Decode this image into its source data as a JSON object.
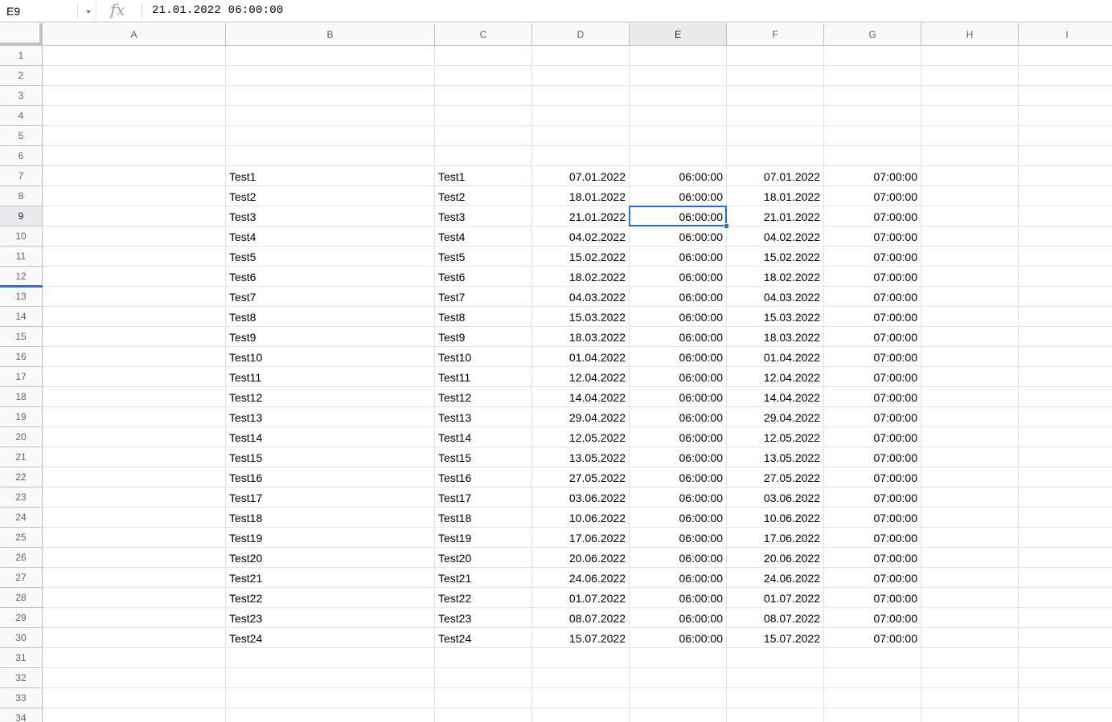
{
  "name_box": {
    "value": "E9"
  },
  "formula_bar": {
    "fx_label": "fx",
    "content": "21.01.2022 06:00:00"
  },
  "sheet": {
    "columns": [
      "A",
      "B",
      "C",
      "D",
      "E",
      "F",
      "G",
      "H",
      "I"
    ],
    "row_numbers": [
      1,
      2,
      3,
      4,
      5,
      6,
      7,
      8,
      9,
      10,
      11,
      12,
      13,
      14,
      15,
      16,
      17,
      18,
      19,
      20,
      21,
      22,
      23,
      24,
      25,
      26,
      27,
      28,
      29,
      30,
      31,
      32,
      33,
      34
    ],
    "active_column": "E",
    "active_row": 9,
    "data_start_row": 7,
    "data_rows": [
      {
        "b": "Test1",
        "c": "Test1",
        "d": "07.01.2022",
        "e": "06:00:00",
        "f": "07.01.2022",
        "g": "07:00:00"
      },
      {
        "b": "Test2",
        "c": "Test2",
        "d": "18.01.2022",
        "e": "06:00:00",
        "f": "18.01.2022",
        "g": "07:00:00"
      },
      {
        "b": "Test3",
        "c": "Test3",
        "d": "21.01.2022",
        "e": "06:00:00",
        "f": "21.01.2022",
        "g": "07:00:00"
      },
      {
        "b": "Test4",
        "c": "Test4",
        "d": "04.02.2022",
        "e": "06:00:00",
        "f": "04.02.2022",
        "g": "07:00:00"
      },
      {
        "b": "Test5",
        "c": "Test5",
        "d": "15.02.2022",
        "e": "06:00:00",
        "f": "15.02.2022",
        "g": "07:00:00"
      },
      {
        "b": "Test6",
        "c": "Test6",
        "d": "18.02.2022",
        "e": "06:00:00",
        "f": "18.02.2022",
        "g": "07:00:00"
      },
      {
        "b": "Test7",
        "c": "Test7",
        "d": "04.03.2022",
        "e": "06:00:00",
        "f": "04.03.2022",
        "g": "07:00:00"
      },
      {
        "b": "Test8",
        "c": "Test8",
        "d": "15.03.2022",
        "e": "06:00:00",
        "f": "15.03.2022",
        "g": "07:00:00"
      },
      {
        "b": "Test9",
        "c": "Test9",
        "d": "18.03.2022",
        "e": "06:00:00",
        "f": "18.03.2022",
        "g": "07:00:00"
      },
      {
        "b": "Test10",
        "c": "Test10",
        "d": "01.04.2022",
        "e": "06:00:00",
        "f": "01.04.2022",
        "g": "07:00:00"
      },
      {
        "b": "Test11",
        "c": "Test11",
        "d": "12.04.2022",
        "e": "06:00:00",
        "f": "12.04.2022",
        "g": "07:00:00"
      },
      {
        "b": "Test12",
        "c": "Test12",
        "d": "14.04.2022",
        "e": "06:00:00",
        "f": "14.04.2022",
        "g": "07:00:00"
      },
      {
        "b": "Test13",
        "c": "Test13",
        "d": "29.04.2022",
        "e": "06:00:00",
        "f": "29.04.2022",
        "g": "07:00:00"
      },
      {
        "b": "Test14",
        "c": "Test14",
        "d": "12.05.2022",
        "e": "06:00:00",
        "f": "12.05.2022",
        "g": "07:00:00"
      },
      {
        "b": "Test15",
        "c": "Test15",
        "d": "13.05.2022",
        "e": "06:00:00",
        "f": "13.05.2022",
        "g": "07:00:00"
      },
      {
        "b": "Test16",
        "c": "Test16",
        "d": "27.05.2022",
        "e": "06:00:00",
        "f": "27.05.2022",
        "g": "07:00:00"
      },
      {
        "b": "Test17",
        "c": "Test17",
        "d": "03.06.2022",
        "e": "06:00:00",
        "f": "03.06.2022",
        "g": "07:00:00"
      },
      {
        "b": "Test18",
        "c": "Test18",
        "d": "10.06.2022",
        "e": "06:00:00",
        "f": "10.06.2022",
        "g": "07:00:00"
      },
      {
        "b": "Test19",
        "c": "Test19",
        "d": "17.06.2022",
        "e": "06:00:00",
        "f": "17.06.2022",
        "g": "07:00:00"
      },
      {
        "b": "Test20",
        "c": "Test20",
        "d": "20.06.2022",
        "e": "06:00:00",
        "f": "20.06.2022",
        "g": "07:00:00"
      },
      {
        "b": "Test21",
        "c": "Test21",
        "d": "24.06.2022",
        "e": "06:00:00",
        "f": "24.06.2022",
        "g": "07:00:00"
      },
      {
        "b": "Test22",
        "c": "Test22",
        "d": "01.07.2022",
        "e": "06:00:00",
        "f": "01.07.2022",
        "g": "07:00:00"
      },
      {
        "b": "Test23",
        "c": "Test23",
        "d": "08.07.2022",
        "e": "06:00:00",
        "f": "08.07.2022",
        "g": "07:00:00"
      },
      {
        "b": "Test24",
        "c": "Test24",
        "d": "15.07.2022",
        "e": "06:00:00",
        "f": "15.07.2022",
        "g": "07:00:00"
      }
    ]
  },
  "colors": {
    "selection": "#1a73e8",
    "header_bg": "#f8f9fa",
    "active_header_bg": "#e8eaed"
  }
}
